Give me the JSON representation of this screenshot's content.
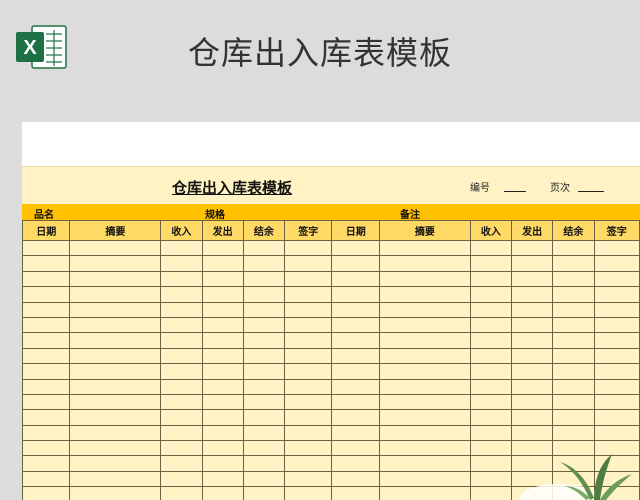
{
  "banner": {
    "title": "仓库出入库表模板",
    "logo_letter": "X"
  },
  "sheet": {
    "title": "仓库出入库表模板",
    "number_label": "编号",
    "page_label": "页次",
    "info": {
      "product_label": "品名",
      "spec_label": "规格",
      "note_label": "备注"
    },
    "columns": [
      "日期",
      "摘要",
      "收入",
      "发出",
      "结余",
      "签字",
      "日期",
      "摘要",
      "收入",
      "发出",
      "结余",
      "签字"
    ],
    "row_count": 17
  },
  "colors": {
    "header_bg": "#ffd966",
    "info_bg": "#ffc000",
    "cell_bg": "#fff2c4",
    "excel_green": "#1e7145"
  }
}
